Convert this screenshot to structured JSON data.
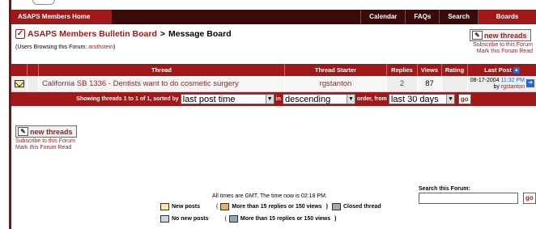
{
  "nav": {
    "home": "ASAPS Members Home",
    "calendar": "Calendar",
    "faqs": "FAQs",
    "search": "Search",
    "boards_home": "Boards Home"
  },
  "header": {
    "board_name": "ASAPS Members Bulletin Board",
    "separator": ">",
    "page": "Message Board",
    "browsing_prefix": "(Users Browsing this Forum: ",
    "browsing_user": "arothstein",
    "browsing_suffix": ")"
  },
  "actions": {
    "new_threads": "new threads",
    "subscribe": "Subscribe to this Forum",
    "mark_read": "Mark this Forum Read"
  },
  "table": {
    "headers": {
      "thread": "Thread",
      "starter": "Thread Starter",
      "replies": "Replies",
      "views": "Views",
      "rating": "Rating",
      "last_post": "Last Post"
    },
    "rows": [
      {
        "title": "California SB 1336 - Dentists want to do cosmetic surgery",
        "starter": "rgstanton",
        "replies": "2",
        "views": "87",
        "rating": "",
        "last_date": "08-17-2004",
        "last_time": "11:32 PM",
        "last_by_prefix": "by",
        "last_by": "rgstanton"
      }
    ]
  },
  "sort": {
    "showing": "Showing threads 1 to 1 of 1, sorted by",
    "sort_by": "last post time",
    "in_label": "in",
    "order": "descending",
    "order_label": "order, from",
    "range": "last 30 days",
    "go": "go"
  },
  "search": {
    "label": "Search this Forum:",
    "value": "",
    "go": "go"
  },
  "footer": {
    "time_text": "All times are GMT. The time now is 02:18 PM."
  },
  "legend": {
    "new_posts": "New posts",
    "hot_new": "More than 15 replies or 150 views",
    "closed": "Closed thread",
    "no_new": "No new posts",
    "hot_old": "More than 15 replies or 150 views",
    "open_paren": "(",
    "close_paren": ")"
  },
  "colors": {
    "accent": "#a01818",
    "nav_bg": "#3a0a0a",
    "link": "#9b1b1b",
    "time": "#2b67c9"
  }
}
